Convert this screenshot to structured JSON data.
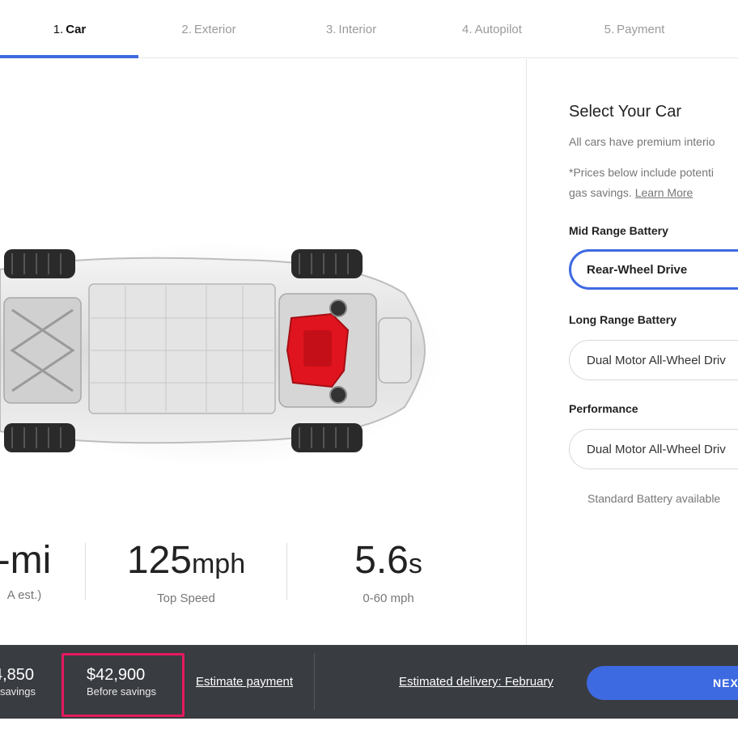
{
  "tabs": [
    {
      "num": "1.",
      "label": "Car"
    },
    {
      "num": "2.",
      "label": "Exterior"
    },
    {
      "num": "3.",
      "label": "Interior"
    },
    {
      "num": "4.",
      "label": "Autopilot"
    },
    {
      "num": "5.",
      "label": "Payment"
    }
  ],
  "active_tab": "Car",
  "specs": [
    {
      "value": "-mi",
      "unit": "",
      "label": "A est.)"
    },
    {
      "value": "125",
      "unit": "mph",
      "label": "Top Speed"
    },
    {
      "value": "5.6",
      "unit": "s",
      "label": "0-60 mph"
    }
  ],
  "panel": {
    "title": "Select Your Car",
    "desc": "All cars have premium interio",
    "note_line1": "*Prices below include potenti",
    "note_line2": "gas savings.",
    "learn_more": "Learn More",
    "groups": [
      {
        "label": "Mid Range Battery",
        "option": "Rear-Wheel Drive",
        "selected": true
      },
      {
        "label": "Long Range Battery",
        "option": "Dual Motor All-Wheel Driv",
        "selected": false
      },
      {
        "label": "Performance",
        "option": "Dual Motor All-Wheel Driv",
        "selected": false
      }
    ],
    "footnote": "Standard Battery available"
  },
  "bottom_bar": {
    "after_savings_amount": "4,850",
    "after_savings_label": "r savings",
    "before_savings_amount": "$42,900",
    "before_savings_label": "Before savings",
    "estimate_payment": "Estimate payment",
    "delivery": "Estimated delivery: February",
    "next_button": "NEXT"
  },
  "colors": {
    "accent_blue": "#3e6ae1",
    "bar_background": "#393c41",
    "highlight": "#e6195d",
    "motor_red": "#e0141e"
  }
}
